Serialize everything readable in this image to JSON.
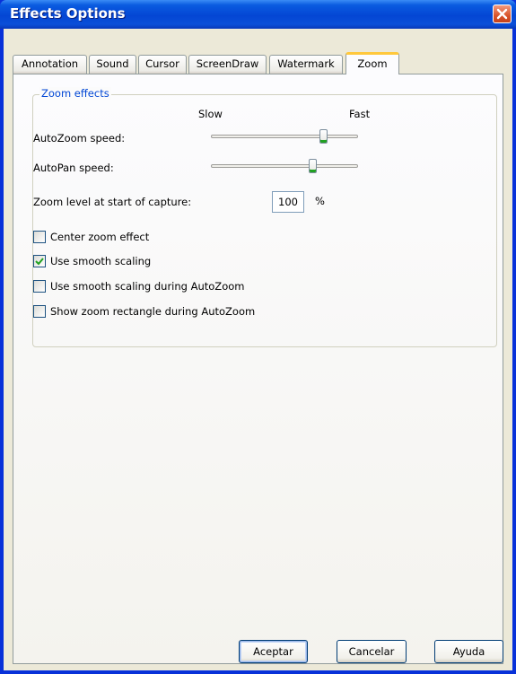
{
  "window": {
    "title": "Effects Options"
  },
  "tabs": [
    {
      "label": "Annotation",
      "active": false
    },
    {
      "label": "Sound",
      "active": false
    },
    {
      "label": "Cursor",
      "active": false
    },
    {
      "label": "ScreenDraw",
      "active": false
    },
    {
      "label": "Watermark",
      "active": false
    },
    {
      "label": "Zoom",
      "active": true
    }
  ],
  "zoom": {
    "group_title": "Zoom effects",
    "scale_slow": "Slow",
    "scale_fast": "Fast",
    "autozoom_label": "AutoZoom speed:",
    "autozoom_position": 0.78,
    "autopan_label": "AutoPan speed:",
    "autopan_position": 0.7,
    "zoom_level_label": "Zoom level at start of capture:",
    "zoom_level_value": "100",
    "zoom_level_unit": "%",
    "options": [
      {
        "label": "Center zoom effect",
        "checked": false
      },
      {
        "label": "Use smooth scaling",
        "checked": true
      },
      {
        "label": "Use smooth scaling during AutoZoom",
        "checked": false
      },
      {
        "label": "Show zoom rectangle during AutoZoom",
        "checked": false
      }
    ]
  },
  "buttons": {
    "ok": "Aceptar",
    "cancel": "Cancelar",
    "help": "Ayuda"
  },
  "colors": {
    "titlebar": "#0a4fd8",
    "dialog_bg": "#ece9d8",
    "group_title": "#0046d5",
    "active_tab_accent": "#ffc83c",
    "check_mark": "#21a121"
  }
}
